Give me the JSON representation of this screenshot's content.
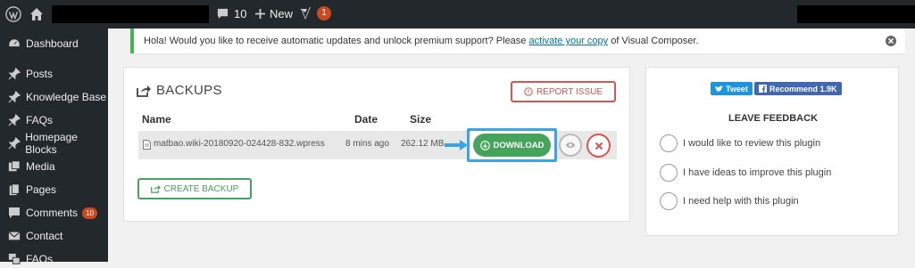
{
  "adminbar": {
    "comments_count": "10",
    "new_label": "New",
    "yoast_badge": "1"
  },
  "sidebar": {
    "items": [
      {
        "label": "Dashboard",
        "icon": "dashboard-icon"
      },
      {
        "label": "Posts",
        "icon": "pin-icon"
      },
      {
        "label": "Knowledge Base",
        "icon": "pin-icon"
      },
      {
        "label": "FAQs",
        "icon": "pin-icon"
      },
      {
        "label": "Homepage Blocks",
        "icon": "pin-icon"
      },
      {
        "label": "Media",
        "icon": "media-icon"
      },
      {
        "label": "Pages",
        "icon": "pages-icon"
      },
      {
        "label": "Comments",
        "icon": "comment-icon",
        "badge": "10"
      },
      {
        "label": "Contact",
        "icon": "mail-icon"
      },
      {
        "label": "FAQs",
        "icon": "faq-icon"
      }
    ]
  },
  "notice": {
    "text_before": "Hola! Would you like to receive automatic updates and unlock premium support? Please ",
    "link_text": "activate your copy",
    "text_after": " of Visual Composer."
  },
  "backups": {
    "title": "BACKUPS",
    "report_label": "REPORT ISSUE",
    "columns": {
      "name": "Name",
      "date": "Date",
      "size": "Size"
    },
    "rows": [
      {
        "name": "matbao.wiki-20180920-024428-832.wpress",
        "date": "8 mins ago",
        "size": "262.12 MB"
      }
    ],
    "download_label": "DOWNLOAD",
    "create_label": "CREATE BACKUP"
  },
  "feedback": {
    "tweet_label": "Tweet",
    "recommend_label": "Recommend 1.9K",
    "title": "LEAVE FEEDBACK",
    "options": [
      "I would like to review this plugin",
      "I have ideas to improve this plugin",
      "I need help with this plugin"
    ]
  },
  "colors": {
    "adminbar_bg": "#23282d",
    "accent_green": "#46a35c",
    "danger_red": "#d9534f",
    "highlight_blue": "#3ba3e8",
    "badge_orange": "#ca4a1f"
  }
}
